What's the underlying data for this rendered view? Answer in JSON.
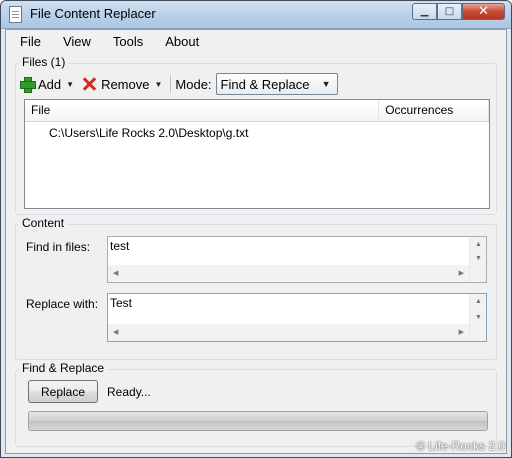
{
  "window": {
    "title": "File Content Replacer"
  },
  "menu": {
    "file": "File",
    "view": "View",
    "tools": "Tools",
    "about": "About"
  },
  "files_group": {
    "label": "Files (1)",
    "add_label": "Add",
    "remove_label": "Remove",
    "mode_label": "Mode:",
    "mode_value": "Find & Replace",
    "columns": [
      "File",
      "Occurrences"
    ],
    "rows": [
      {
        "file": "C:\\Users\\Life Rocks 2.0\\Desktop\\g.txt",
        "occurrences": ""
      }
    ]
  },
  "content_group": {
    "label": "Content",
    "find_label": "Find in files:",
    "find_value": "test",
    "replace_label": "Replace with:",
    "replace_value": "Test"
  },
  "action_group": {
    "label": "Find & Replace",
    "replace_button": "Replace",
    "status": "Ready...",
    "progress": 0
  },
  "watermark": "© Life-Rocks 2.0"
}
